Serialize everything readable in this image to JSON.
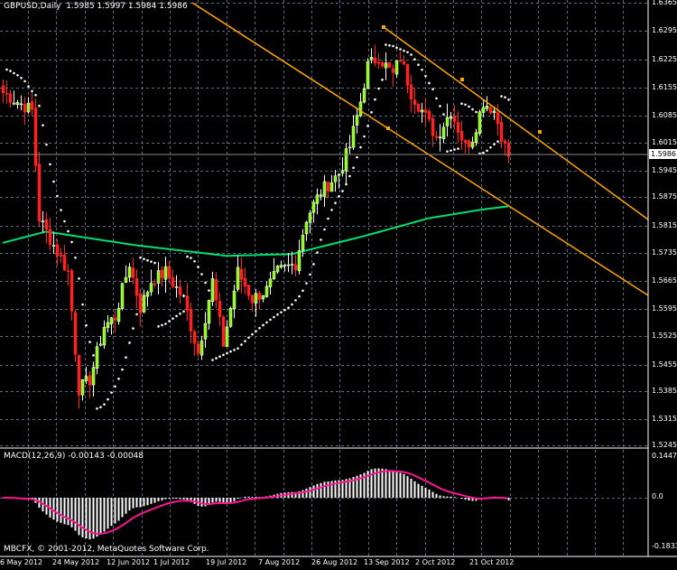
{
  "header": {
    "title": "GBPUSD,Daily",
    "ohlc": "1.5985 1.5997 1.5984 1.5986"
  },
  "macd_header": {
    "label": "MACD(12,26,9) -0.00143 -0.00048"
  },
  "copyright": "MBCFX, © 2001-2012, MetaQuotes Software Corp.",
  "price_axis": [
    "1.6365",
    "1.6295",
    "1.6225",
    "1.6155",
    "1.6085",
    "1.6015",
    "1.5945",
    "1.5875",
    "1.5815",
    "1.5735",
    "1.5665",
    "1.5595",
    "1.5525",
    "1.5455",
    "1.5385",
    "1.5315",
    "1.5245"
  ],
  "current_price": "1.5986",
  "macd_axis": [
    "0.1447",
    "0.0",
    "-0.1833"
  ],
  "date_axis": [
    "6 May 2012",
    "24 May 2012",
    "12 Jun 2012",
    "1 Jul 2012",
    "19 Jul 2012",
    "7 Aug 2012",
    "26 Aug 2012",
    "13 Sep 2012",
    "2 Oct 2012",
    "21 Oct 2012"
  ],
  "colors": {
    "bull": "#ffffff",
    "bear": "#ff2020",
    "bull_body": "#7fff00",
    "ma": "#00e070",
    "channel": "#ffa500",
    "signal": "#ff1493",
    "grid": "#5a6a80",
    "sar": "#ffffff"
  },
  "chart_data": {
    "type": "candlestick",
    "symbol": "GBPUSD",
    "timeframe": "Daily",
    "bars": 141,
    "close_keypoints": [
      [
        0,
        1.6117
      ],
      [
        8,
        1.6066
      ],
      [
        10,
        1.576
      ],
      [
        14,
        1.5683
      ],
      [
        18,
        1.5607
      ],
      [
        21,
        1.5275
      ],
      [
        24,
        1.53
      ],
      [
        28,
        1.5453
      ],
      [
        31,
        1.5479
      ],
      [
        35,
        1.5632
      ],
      [
        38,
        1.5504
      ],
      [
        41,
        1.5581
      ],
      [
        45,
        1.5607
      ],
      [
        50,
        1.553
      ],
      [
        54,
        1.5377
      ],
      [
        58,
        1.5581
      ],
      [
        61,
        1.5402
      ],
      [
        65,
        1.5607
      ],
      [
        69,
        1.553
      ],
      [
        73,
        1.5556
      ],
      [
        76,
        1.5607
      ],
      [
        81,
        1.5632
      ],
      [
        84,
        1.576
      ],
      [
        88,
        1.5836
      ],
      [
        93,
        1.5887
      ],
      [
        96,
        1.5964
      ],
      [
        99,
        1.6092
      ],
      [
        101,
        1.6194
      ],
      [
        104,
        1.6219
      ],
      [
        108,
        1.6168
      ],
      [
        110,
        1.6219
      ],
      [
        113,
        1.6117
      ],
      [
        116,
        1.6066
      ],
      [
        120,
        1.599
      ],
      [
        124,
        1.6066
      ],
      [
        128,
        1.5964
      ],
      [
        130,
        1.599
      ],
      [
        133,
        1.6092
      ],
      [
        136,
        1.6066
      ],
      [
        139,
        1.5964
      ],
      [
        140,
        1.5936
      ]
    ],
    "ma_keypoints": [
      [
        0,
        1.569
      ],
      [
        12,
        1.5722
      ],
      [
        37,
        1.5683
      ],
      [
        62,
        1.5653
      ],
      [
        80,
        1.5658
      ],
      [
        100,
        1.5709
      ],
      [
        118,
        1.576
      ],
      [
        133,
        1.5785
      ],
      [
        141,
        1.5795
      ]
    ],
    "price_range": [
      1.5114,
      1.6373
    ],
    "macd": {
      "fast": 12,
      "slow": 26,
      "signal": 9,
      "value": -0.00143,
      "signal_value": -0.00048
    }
  }
}
